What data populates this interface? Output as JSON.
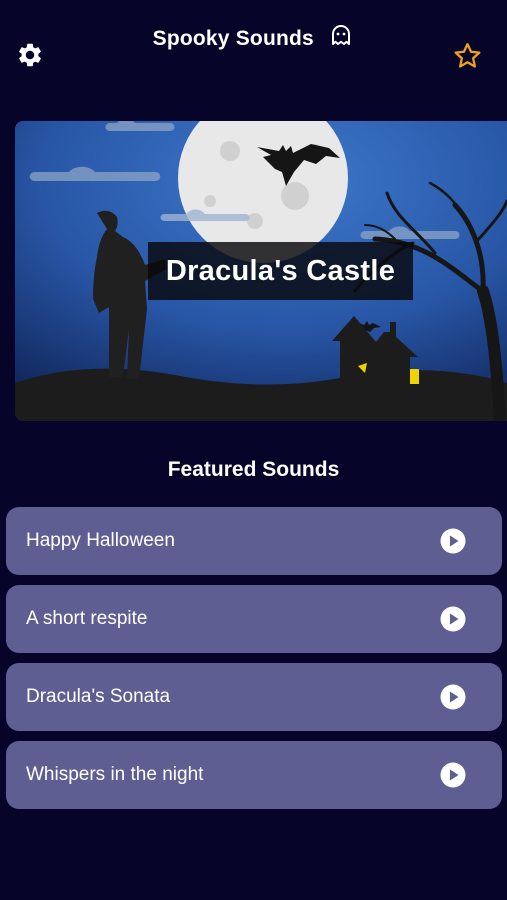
{
  "header": {
    "title": "Spooky Sounds",
    "icons": {
      "settings": "gear-icon",
      "logo": "ghost-icon",
      "favorite": "star-icon"
    },
    "favorite_color": "#f0a21a"
  },
  "hero": {
    "label": "Dracula's Castle",
    "sky_color": "#2f65b8",
    "moon_color": "#e8e8e8"
  },
  "featured": {
    "title": "Featured Sounds",
    "items": [
      {
        "label": "Happy Halloween",
        "icon": "play-icon"
      },
      {
        "label": "A short respite",
        "icon": "play-icon"
      },
      {
        "label": "Dracula's Sonata",
        "icon": "play-icon"
      },
      {
        "label": "Whispers in the night",
        "icon": "play-icon"
      }
    ],
    "item_color": "#5e5e93"
  },
  "background_color": "#07042a"
}
